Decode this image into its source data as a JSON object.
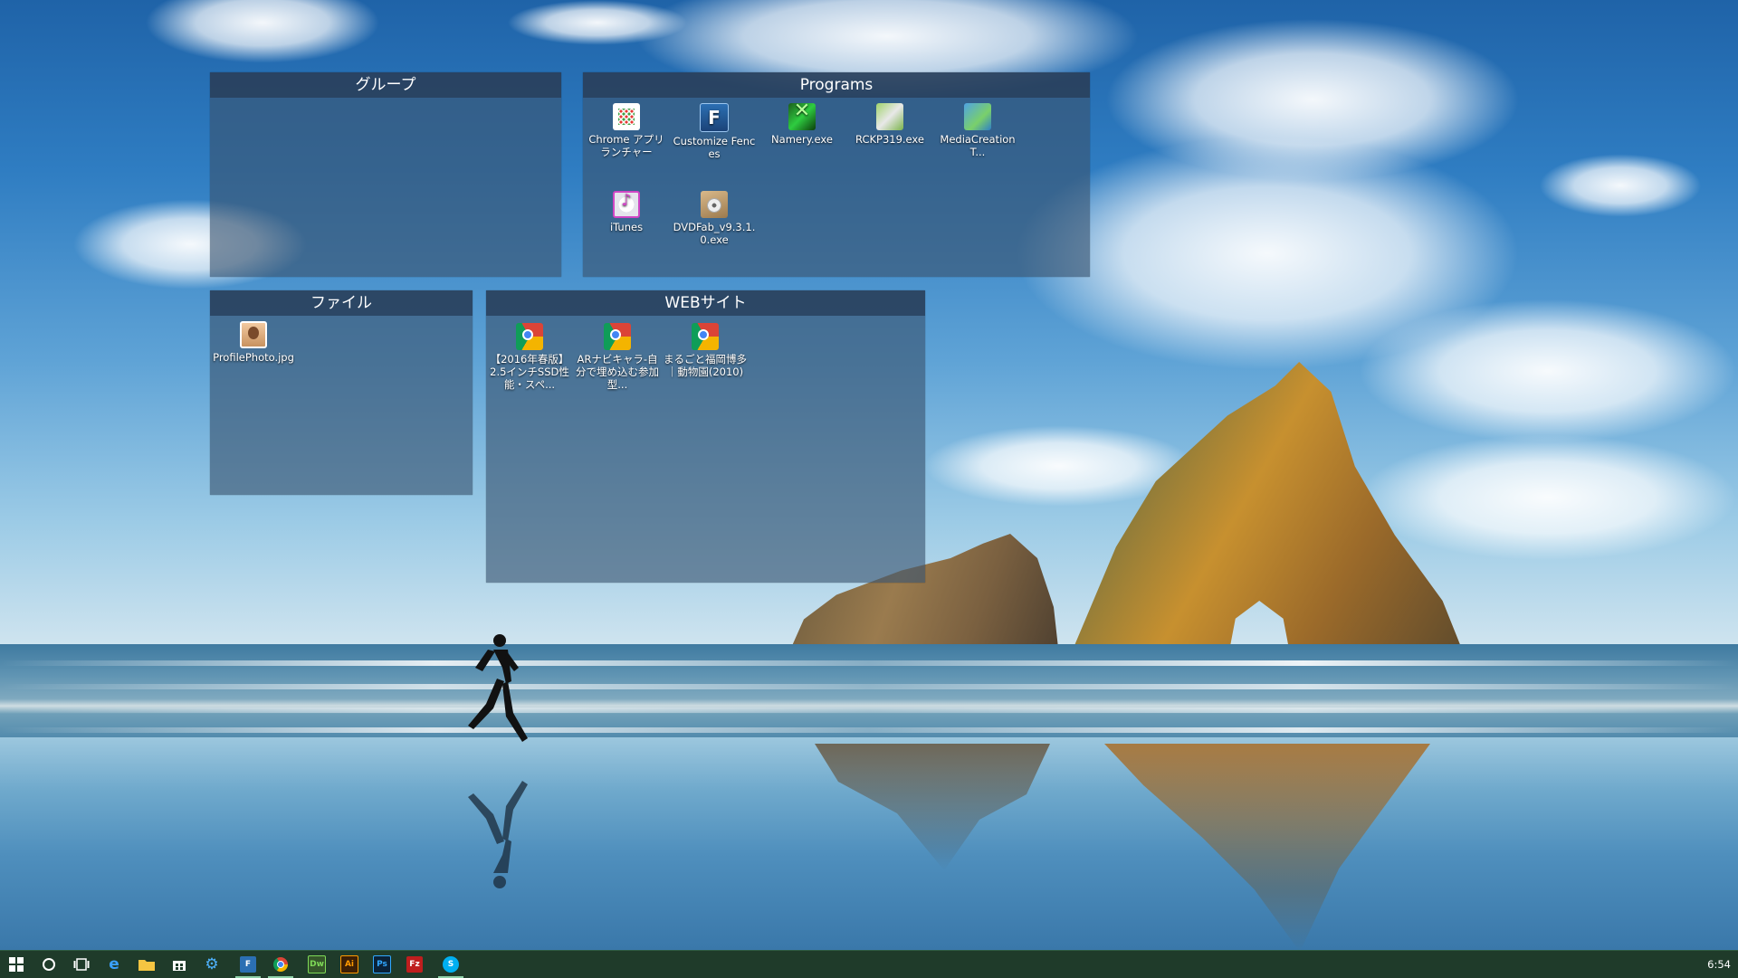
{
  "fences": {
    "group": {
      "title": "グループ"
    },
    "programs": {
      "title": "Programs",
      "items": [
        {
          "label": "Chrome アプリ ランチャー",
          "icon": "chrome-app-launcher-icon"
        },
        {
          "label": "Customize Fences",
          "icon": "fences-icon"
        },
        {
          "label": "Namery.exe",
          "icon": "namery-icon"
        },
        {
          "label": "RCKP319.exe",
          "icon": "rckp-installer-icon"
        },
        {
          "label": "MediaCreationT...",
          "icon": "media-creation-tool-icon"
        },
        {
          "label": "iTunes",
          "icon": "itunes-icon"
        },
        {
          "label": "DVDFab_v9.3.1.0.exe",
          "icon": "dvdfab-icon"
        }
      ]
    },
    "files": {
      "title": "ファイル",
      "items": [
        {
          "label": "ProfilePhoto.jpg",
          "icon": "photo-file-icon"
        }
      ]
    },
    "websites": {
      "title": "WEBサイト",
      "items": [
        {
          "label": "【2016年春版】2.5インチSSD性能・スペ...",
          "icon": "chrome-icon"
        },
        {
          "label": "ARナビキャラ-自分で埋め込む参加型...",
          "icon": "chrome-icon"
        },
        {
          "label": "まるごと福岡博多｜動物園(2010)",
          "icon": "chrome-icon"
        }
      ]
    }
  },
  "taskbar": {
    "items": [
      {
        "name": "start-button",
        "icon": "windows-logo-icon"
      },
      {
        "name": "cortana-button",
        "icon": "circle-icon"
      },
      {
        "name": "task-view-button",
        "icon": "task-view-icon"
      },
      {
        "name": "edge-button",
        "icon": "edge-icon"
      },
      {
        "name": "file-explorer-button",
        "icon": "folder-icon"
      },
      {
        "name": "store-button",
        "icon": "store-icon"
      },
      {
        "name": "settings-button",
        "icon": "gear-icon"
      },
      {
        "name": "fences-taskbar-button",
        "icon": "fences-icon"
      },
      {
        "name": "chrome-taskbar-button",
        "icon": "chrome-icon"
      },
      {
        "name": "dreamweaver-button",
        "icon": "dreamweaver-icon",
        "text": "Dw"
      },
      {
        "name": "illustrator-button",
        "icon": "illustrator-icon",
        "text": "Ai"
      },
      {
        "name": "photoshop-button",
        "icon": "photoshop-icon",
        "text": "Ps"
      },
      {
        "name": "filezilla-button",
        "icon": "filezilla-icon",
        "text": "Fz"
      },
      {
        "name": "skype-button",
        "icon": "skype-icon",
        "text": "S"
      }
    ],
    "clock": "6:54"
  },
  "colors": {
    "fence_body": "#3a5470",
    "fence_title": "#263c58",
    "taskbar": "#1f3b2a"
  }
}
